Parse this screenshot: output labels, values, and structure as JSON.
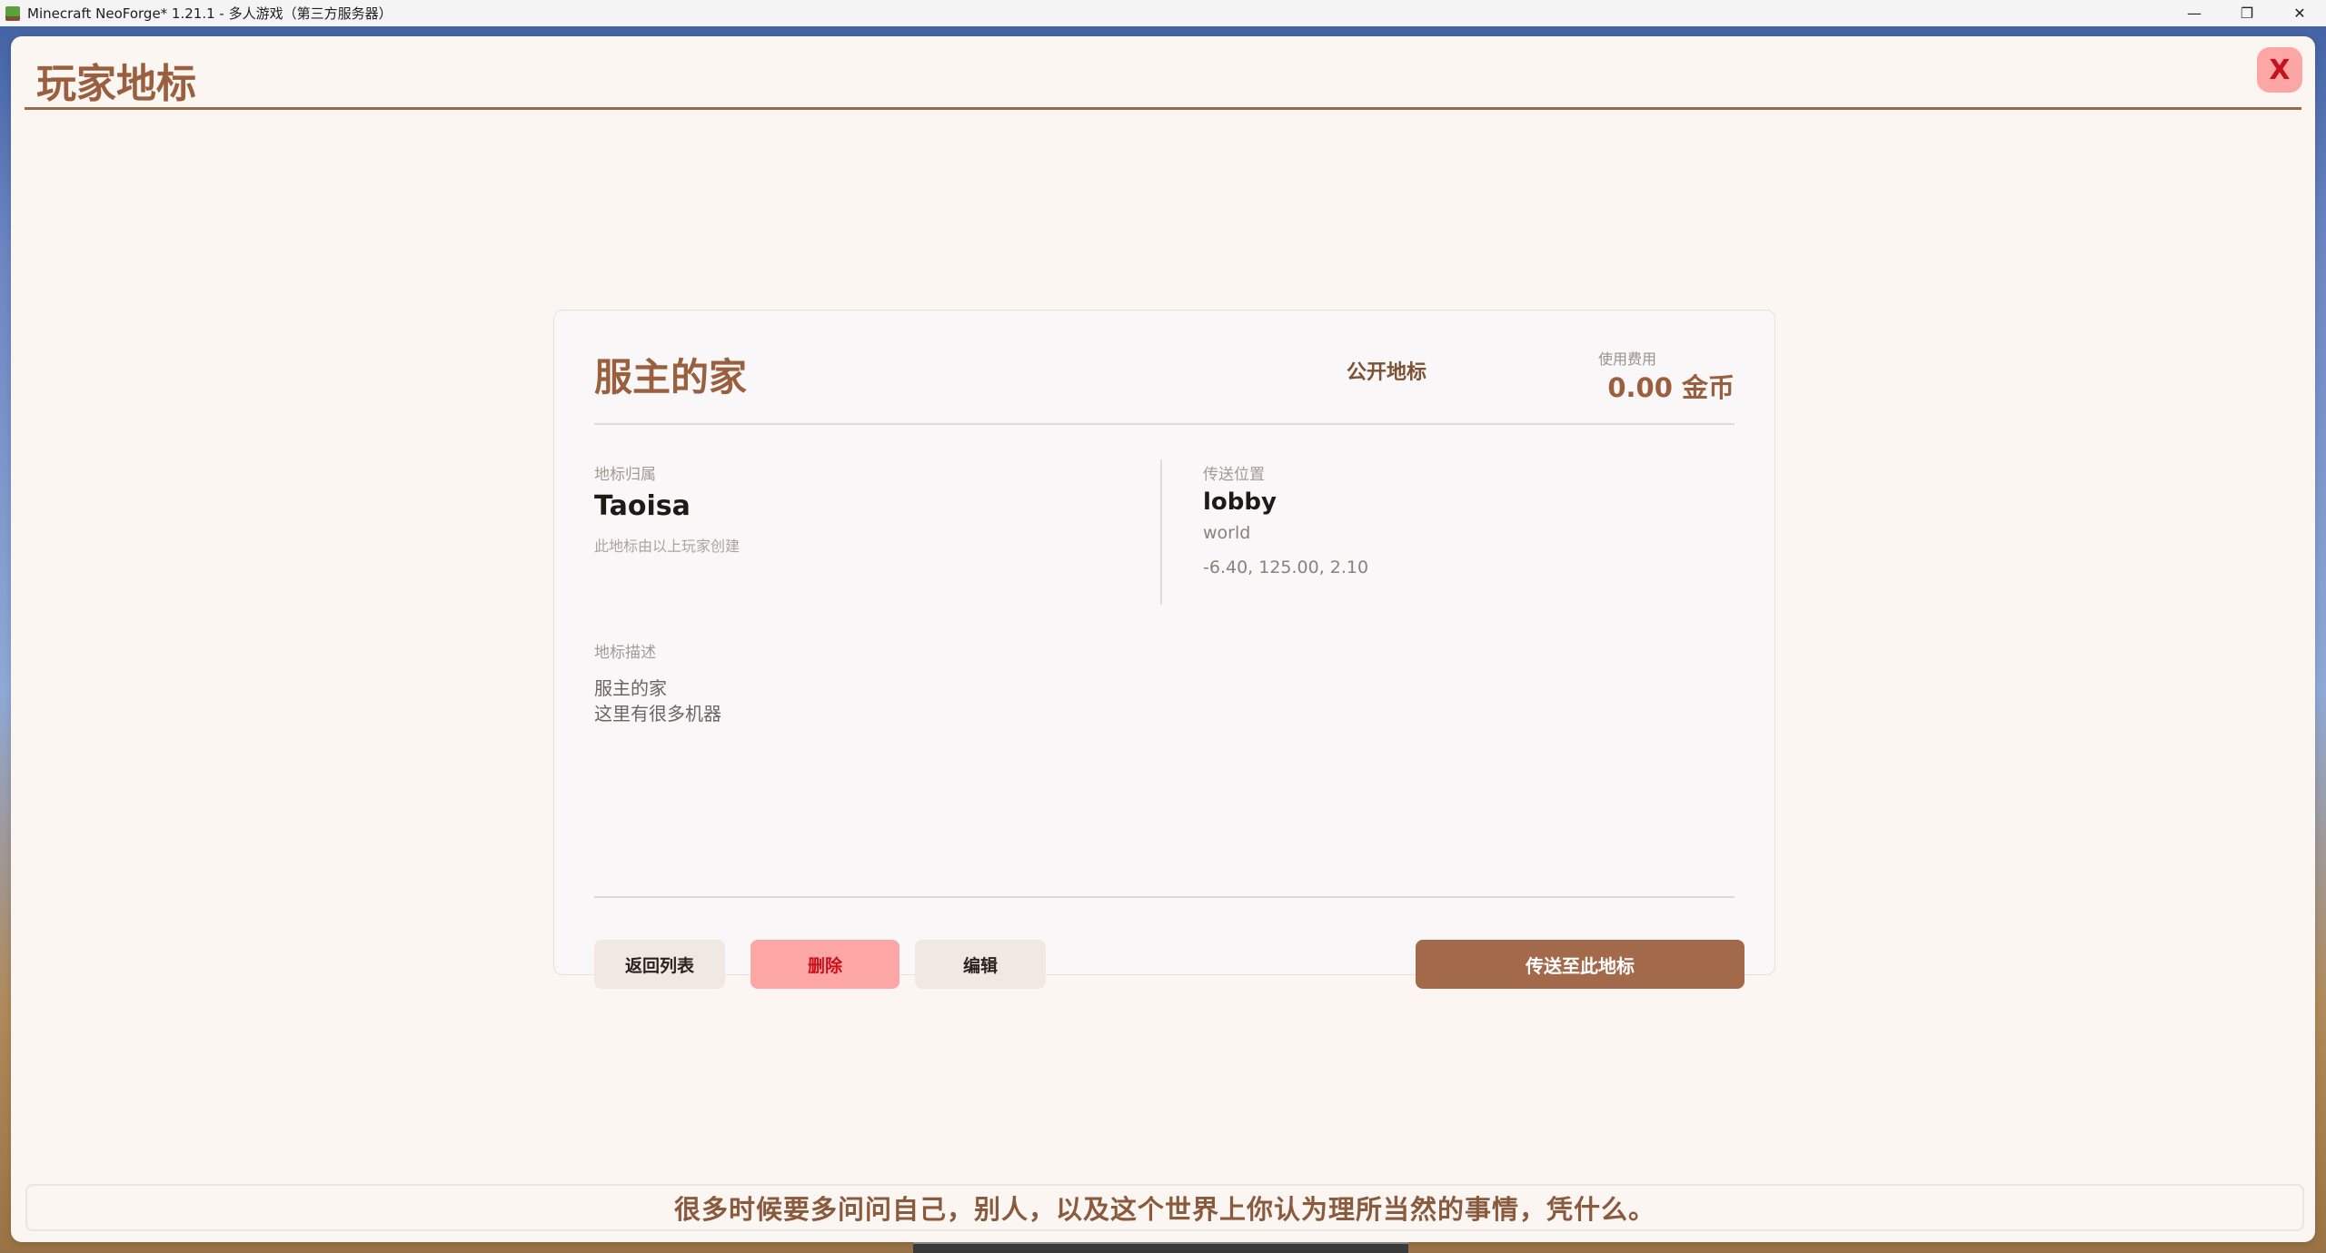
{
  "window": {
    "title": "Minecraft NeoForge* 1.21.1 - 多人游戏（第三方服务器）",
    "minimize_glyph": "—",
    "restore_glyph": "❐",
    "close_glyph": "✕"
  },
  "panel": {
    "title": "玩家地标",
    "close_label": "X"
  },
  "landmark": {
    "name": "服主的家",
    "visibility": "公开地标",
    "fee_label": "使用费用",
    "fee_value": "0.00 金币",
    "owner_label": "地标归属",
    "owner_name": "Taoisa",
    "owner_note": "此地标由以上玩家创建",
    "location_label": "传送位置",
    "location_name": "lobby",
    "world": "world",
    "coords": "-6.40, 125.00, 2.10",
    "description_label": "地标描述",
    "description_lines": [
      "服主的家",
      "这里有很多机器"
    ]
  },
  "actions": {
    "back": "返回列表",
    "delete": "删除",
    "edit": "编辑",
    "teleport": "传送至此地标"
  },
  "footer": {
    "quote": "很多时候要多问问自己，别人，以及这个世界上你认为理所当然的事情，凭什么。"
  },
  "colors": {
    "accent_brown": "#9a5f3e",
    "delete_bg": "#fca6a6",
    "delete_text": "#c9101e",
    "teleport_bg": "#a26a4a"
  }
}
